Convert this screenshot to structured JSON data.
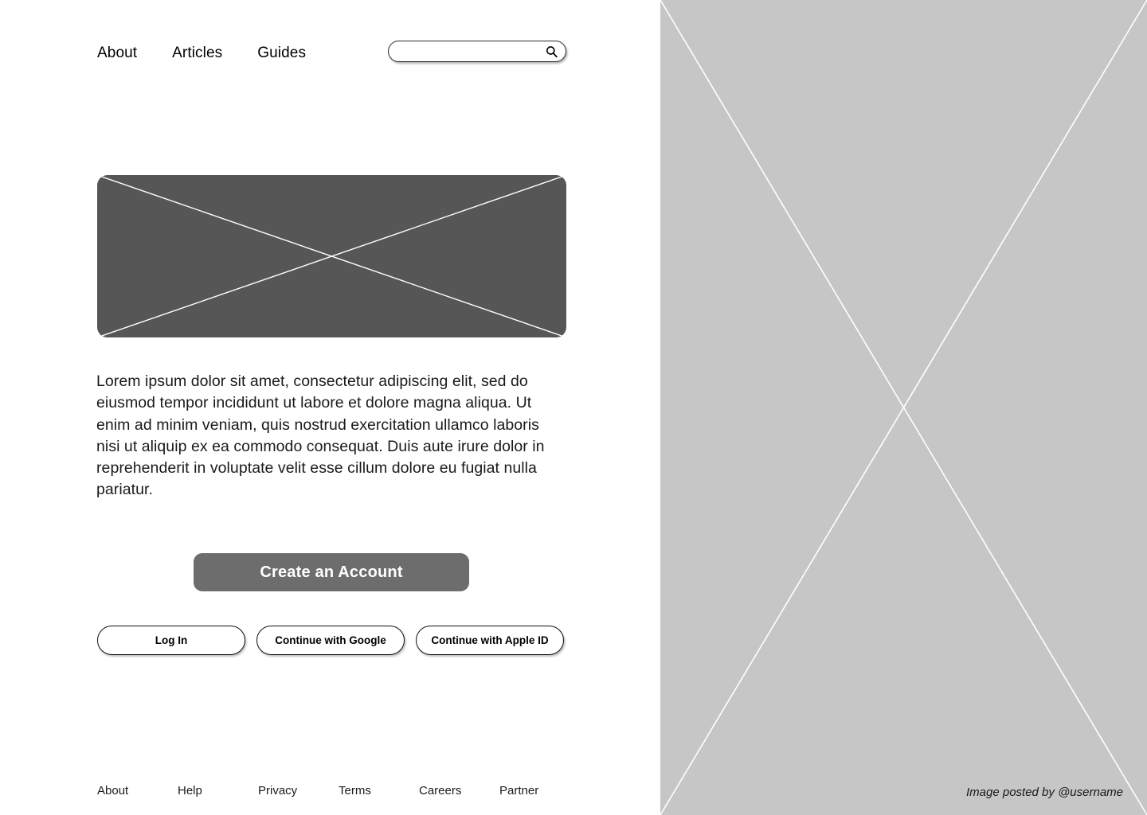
{
  "nav": {
    "items": [
      {
        "label": "About"
      },
      {
        "label": "Articles"
      },
      {
        "label": "Guides"
      }
    ]
  },
  "search": {
    "value": "",
    "placeholder": "",
    "icon": "search-icon"
  },
  "hero": {
    "placeholder_icon": "image-placeholder-x",
    "fill_color": "#565656",
    "line_color": "#ffffff"
  },
  "main": {
    "body_text": "Lorem ipsum dolor sit amet, consectetur adipiscing elit, sed do eiusmod tempor incididunt ut labore et dolore magna aliqua. Ut enim ad minim veniam, quis nostrud exercitation ullamco laboris nisi ut aliquip ex ea commodo consequat. Duis aute irure dolor in reprehenderit in voluptate velit esse cillum dolore eu fugiat nulla pariatur.",
    "primary_cta": "Create an Account",
    "auth_buttons": [
      {
        "label": "Log In"
      },
      {
        "label": "Continue with Google"
      },
      {
        "label": "Continue with Apple ID"
      }
    ]
  },
  "footer": {
    "links": [
      {
        "label": "About"
      },
      {
        "label": "Help"
      },
      {
        "label": "Privacy"
      },
      {
        "label": "Terms"
      },
      {
        "label": "Careers"
      },
      {
        "label": "Partner"
      }
    ]
  },
  "right_panel": {
    "caption": "Image posted by @username",
    "fill_color": "#c6c6c6",
    "line_color": "#ffffff"
  },
  "colors": {
    "page_background": "#ffffff",
    "primary_button": "#6d6d6d",
    "placeholder_gray": "#565656",
    "panel_gray": "#c6c6c6",
    "text": "#000000"
  }
}
